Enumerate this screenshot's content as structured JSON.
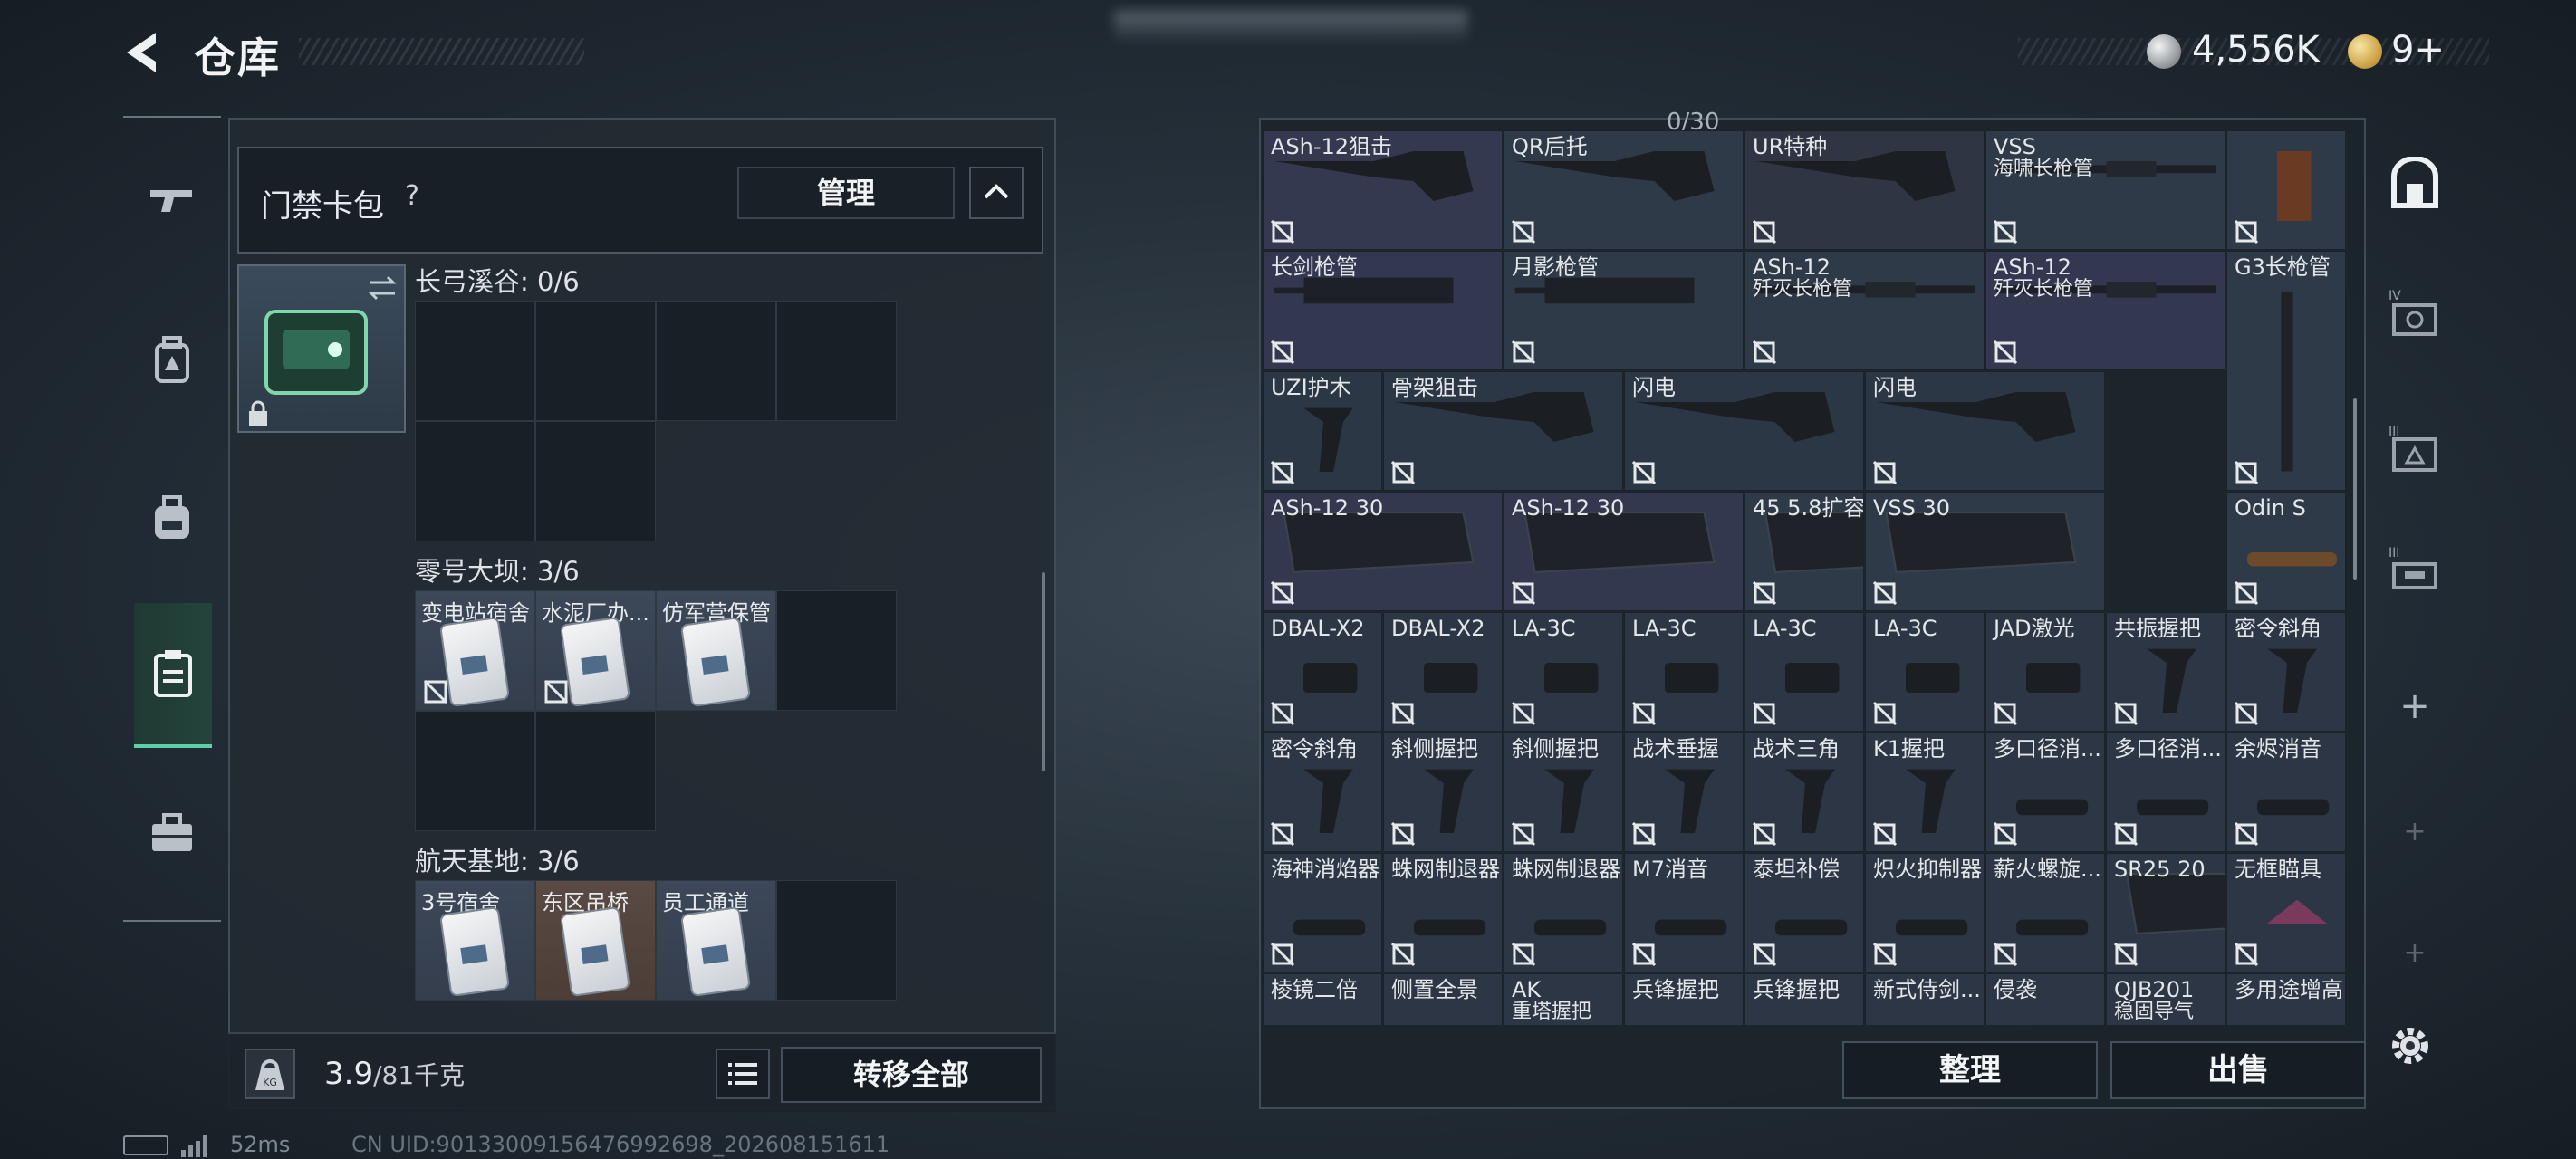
{
  "header": {
    "title": "仓库"
  },
  "currency": [
    {
      "icon": "silver-coin-icon",
      "value": "4,556K"
    },
    {
      "icon": "gold-coin-icon",
      "value": "9+"
    }
  ],
  "rail": {
    "items": [
      "rifle-icon",
      "backpack-armor-icon",
      "backpack-icon",
      "keycard-case-icon",
      "toolbox-icon"
    ],
    "active": 3
  },
  "cardpack": {
    "title": "门禁卡包",
    "help": "?",
    "manage_label": "管理",
    "sections": [
      {
        "label": "长弓溪谷: 0/6",
        "cards": []
      },
      {
        "label": "零号大坝: 3/6",
        "cards": [
          "变电站宿舍",
          "水泥厂办...",
          "仿军营保管"
        ]
      },
      {
        "label": "航天基地: 3/6",
        "cards": [
          "3号宿舍",
          "东区吊桥",
          "员工通道"
        ]
      }
    ]
  },
  "capacity": {
    "value": "3.9",
    "max": "/81千克",
    "unit_icon": "KG"
  },
  "actions": {
    "transfer_all": "转移全部",
    "sort": "整理",
    "sell": "出售"
  },
  "top_partial": "0/30",
  "items": [
    {
      "name": "ASh-12狙击"
    },
    {
      "name": "QR后托"
    },
    {
      "name": "UR特种"
    },
    {
      "name": "VSS",
      "sub": "海啸长枪管"
    },
    {
      "name": ""
    },
    {
      "name": "长剑枪管"
    },
    {
      "name": "月影枪管"
    },
    {
      "name": "ASh-12",
      "sub": "歼灭长枪管"
    },
    {
      "name": "ASh-12",
      "sub": "歼灭长枪管"
    },
    {
      "name": "G3长枪管"
    },
    {
      "name": "UZI护木"
    },
    {
      "name": "骨架狙击"
    },
    {
      "name": "闪电"
    },
    {
      "name": "闪电"
    },
    {
      "name": "ASh-12 30"
    },
    {
      "name": "ASh-12 30"
    },
    {
      "name": "45 5.8扩容"
    },
    {
      "name": "VSS 30"
    },
    {
      "name": "Odin S"
    },
    {
      "name": "DBAL-X2"
    },
    {
      "name": "DBAL-X2"
    },
    {
      "name": "LA-3C"
    },
    {
      "name": "LA-3C"
    },
    {
      "name": "LA-3C"
    },
    {
      "name": "LA-3C"
    },
    {
      "name": "JAD激光"
    },
    {
      "name": "共振握把"
    },
    {
      "name": "密令斜角"
    },
    {
      "name": "密令斜角"
    },
    {
      "name": "斜侧握把"
    },
    {
      "name": "斜侧握把"
    },
    {
      "name": "战术垂握"
    },
    {
      "name": "战术三角"
    },
    {
      "name": "K1握把"
    },
    {
      "name": "多口径消..."
    },
    {
      "name": "多口径消..."
    },
    {
      "name": "余烬消音"
    },
    {
      "name": "海神消焰器"
    },
    {
      "name": "蛛网制退器"
    },
    {
      "name": "蛛网制退器"
    },
    {
      "name": "M7消音"
    },
    {
      "name": "泰坦补偿"
    },
    {
      "name": "炽火抑制器"
    },
    {
      "name": "薪火螺旋..."
    },
    {
      "name": "SR25 20"
    },
    {
      "name": "无框瞄具"
    },
    {
      "name": "棱镜二倍"
    },
    {
      "name": "侧置全景"
    },
    {
      "name": "AK",
      "sub": "重塔握把"
    },
    {
      "name": "兵锋握把"
    },
    {
      "name": "兵锋握把"
    },
    {
      "name": "新式侍剑..."
    },
    {
      "name": "侵袭"
    },
    {
      "name": "QJB201",
      "sub": "稳固导气"
    },
    {
      "name": "多用途增高"
    }
  ],
  "side_tabs": [
    "safe-box-icon",
    "tier-4-case-icon",
    "tier-3-case-icon",
    "tier-3-box-icon",
    "plus-icon",
    "plus-icon",
    "plus-icon"
  ],
  "status": {
    "ping": "52ms",
    "uid": "CN UID:90133009156476992698_202608151611"
  }
}
